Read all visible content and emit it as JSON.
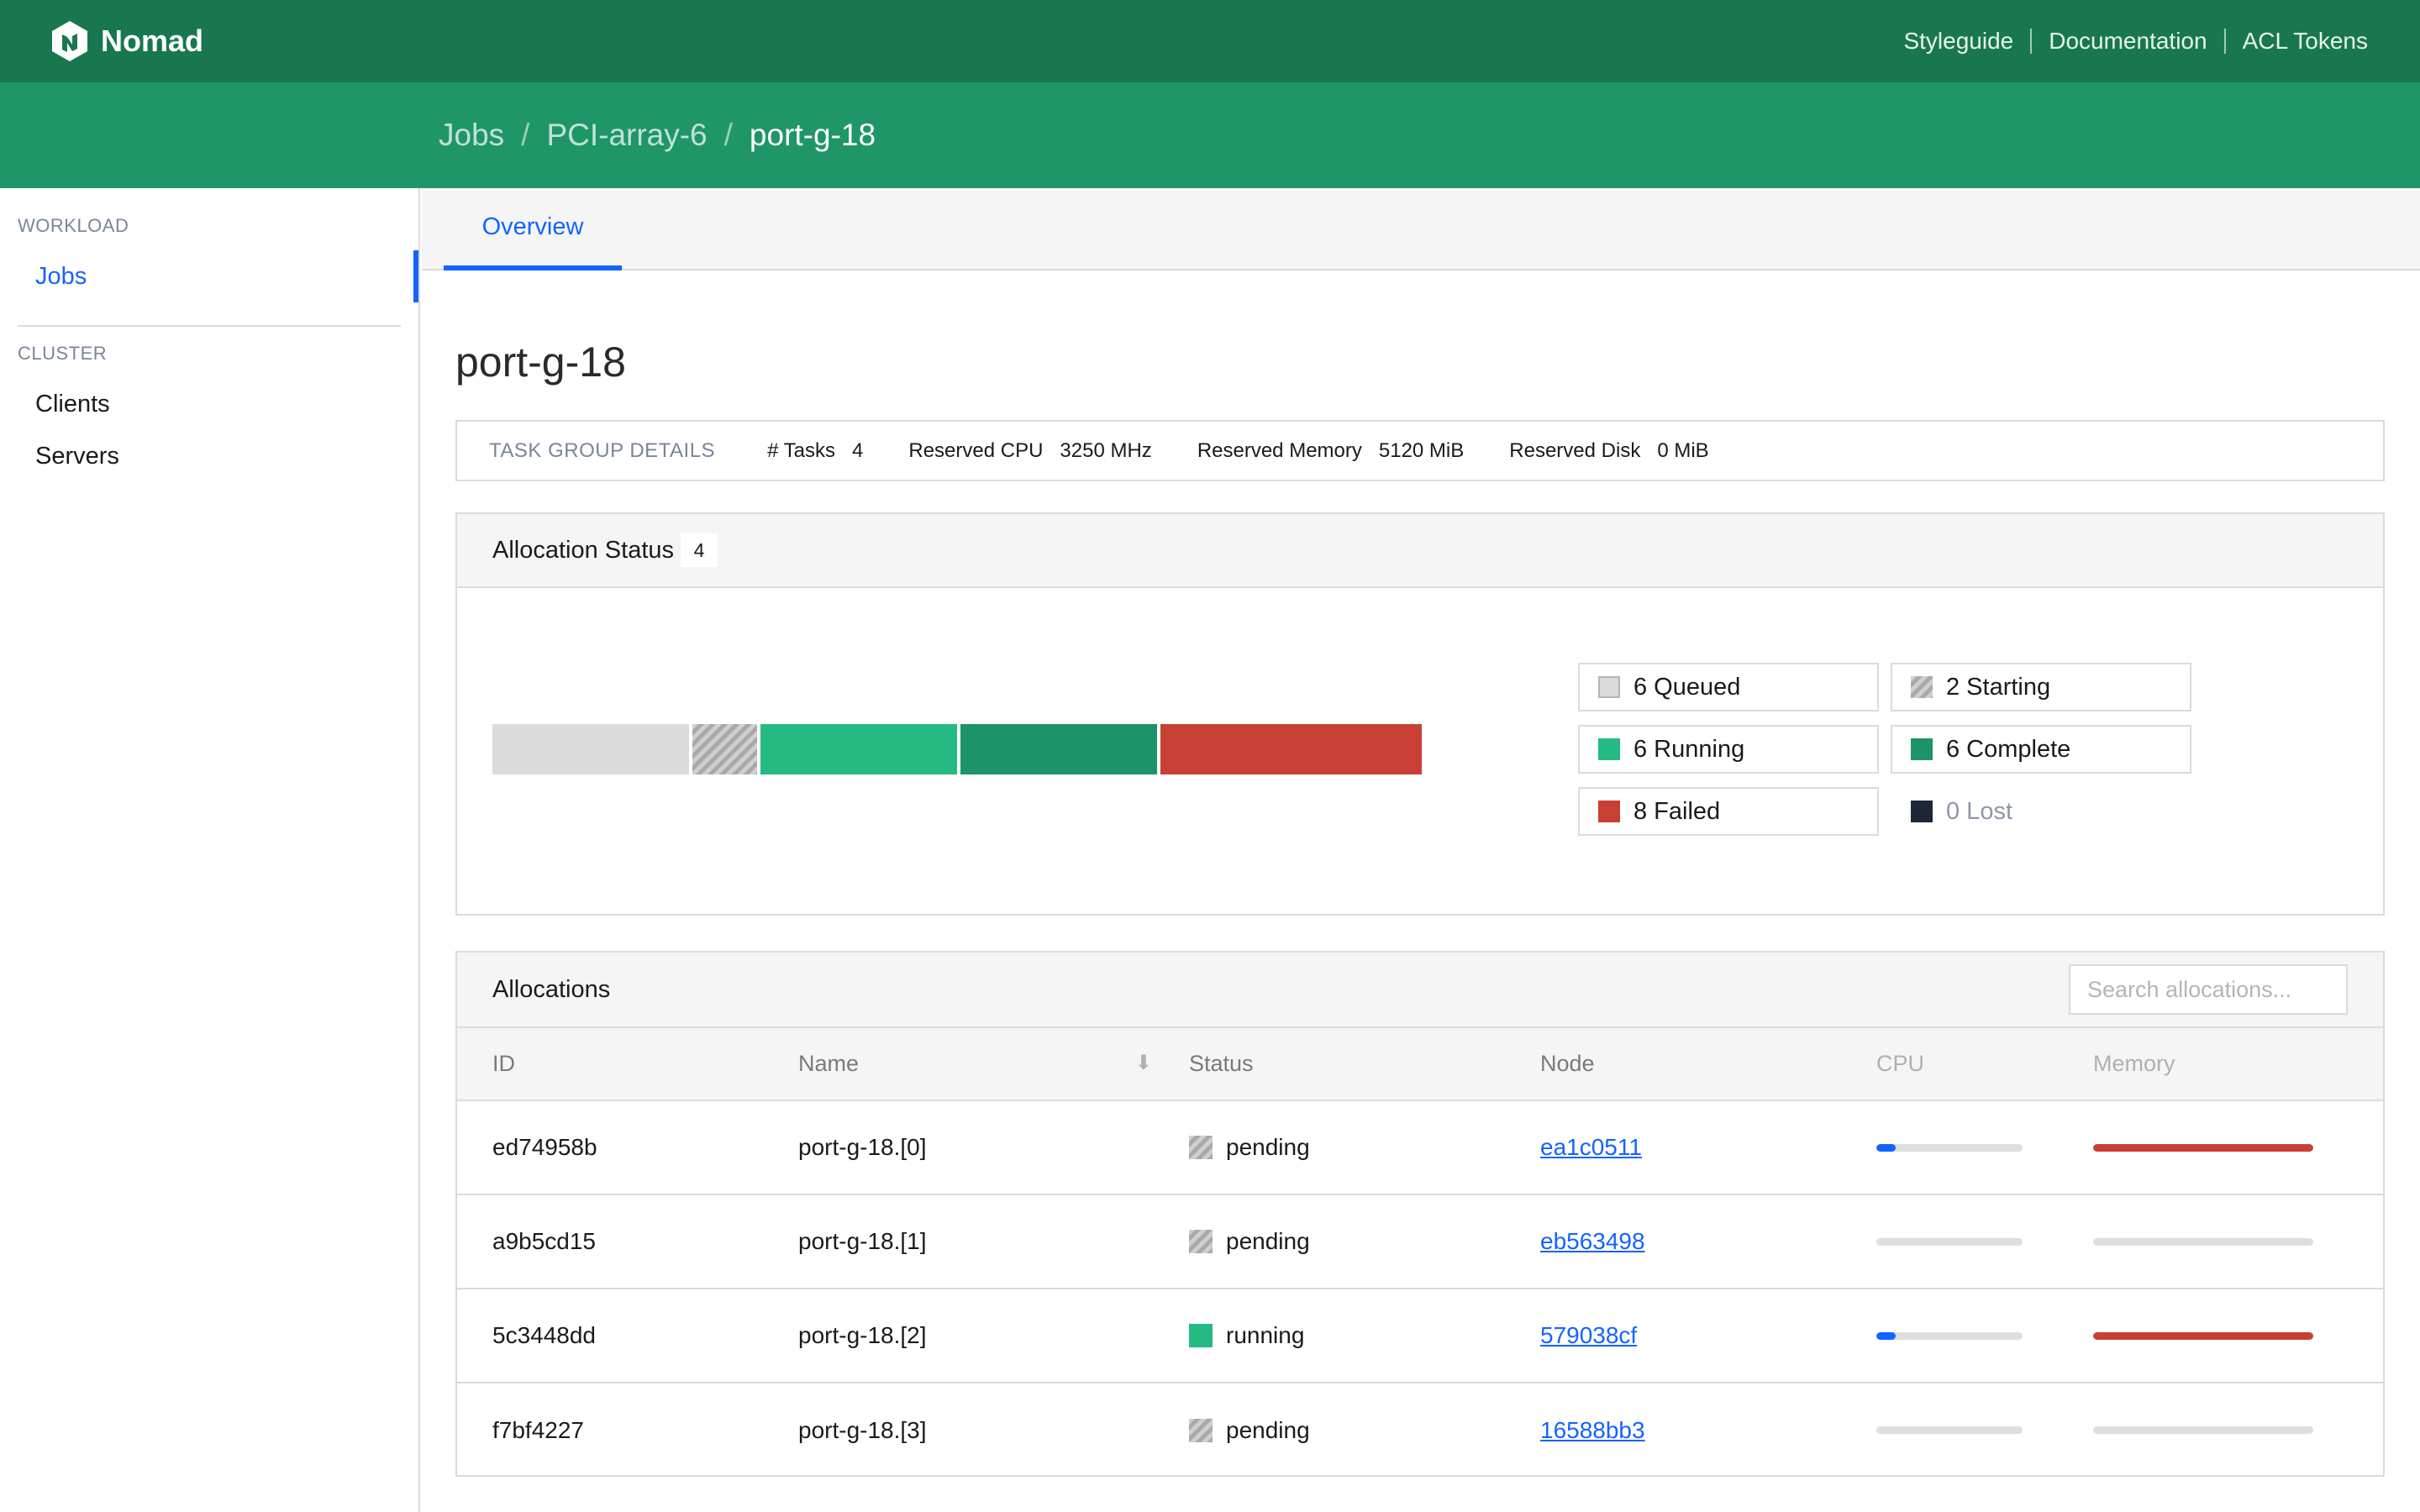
{
  "app": {
    "name": "Nomad"
  },
  "top_links": [
    "Styleguide",
    "Documentation",
    "ACL Tokens"
  ],
  "breadcrumb": [
    "Jobs",
    "PCI-array-6",
    "port-g-18"
  ],
  "sidebar": {
    "sections": [
      {
        "label": "WORKLOAD",
        "items": [
          "Jobs"
        ]
      },
      {
        "label": "CLUSTER",
        "items": [
          "Clients",
          "Servers"
        ]
      }
    ],
    "active_item": "Jobs"
  },
  "tabs": [
    "Overview"
  ],
  "title": "port-g-18",
  "task_group_details": {
    "label": "TASK GROUP DETAILS",
    "pairs": [
      {
        "key": "# Tasks",
        "value": "4"
      },
      {
        "key": "Reserved CPU",
        "value": "3250 MHz"
      },
      {
        "key": "Reserved Memory",
        "value": "5120 MiB"
      },
      {
        "key": "Reserved Disk",
        "value": "0 MiB"
      }
    ]
  },
  "allocation_status": {
    "title": "Allocation Status",
    "count": "4",
    "legend": [
      {
        "count": "6",
        "label": "Queued",
        "color": "#dbdbdb",
        "value": 6
      },
      {
        "count": "2",
        "label": "Starting",
        "color": "hatched-gray",
        "value": 2
      },
      {
        "count": "6",
        "label": "Running",
        "color": "#25ba81",
        "value": 6
      },
      {
        "count": "6",
        "label": "Complete",
        "color": "#1d9467",
        "value": 6
      },
      {
        "count": "8",
        "label": "Failed",
        "color": "#c84034",
        "value": 8
      },
      {
        "count": "0",
        "label": "Lost",
        "color": "#1d2738",
        "value": 0
      }
    ]
  },
  "allocations": {
    "title": "Allocations",
    "search_placeholder": "Search allocations...",
    "columns": [
      "ID",
      "Name",
      "Status",
      "Node",
      "CPU",
      "Memory"
    ],
    "rows": [
      {
        "id": "ed74958b",
        "name": "port-g-18.[0]",
        "status": "pending",
        "node": "ea1c0511",
        "cpu": 0.13,
        "memory": 1.0
      },
      {
        "id": "a9b5cd15",
        "name": "port-g-18.[1]",
        "status": "pending",
        "node": "eb563498",
        "cpu": 0,
        "memory": 0
      },
      {
        "id": "5c3448dd",
        "name": "port-g-18.[2]",
        "status": "running",
        "node": "579038cf",
        "cpu": 0.13,
        "memory": 1.0
      },
      {
        "id": "f7bf4227",
        "name": "port-g-18.[3]",
        "status": "pending",
        "node": "16588bb3",
        "cpu": 0,
        "memory": 0
      }
    ]
  },
  "colors": {
    "brand_dark": "#19774f",
    "brand": "#1f9667",
    "accent": "#1563ff",
    "danger": "#c84034"
  }
}
